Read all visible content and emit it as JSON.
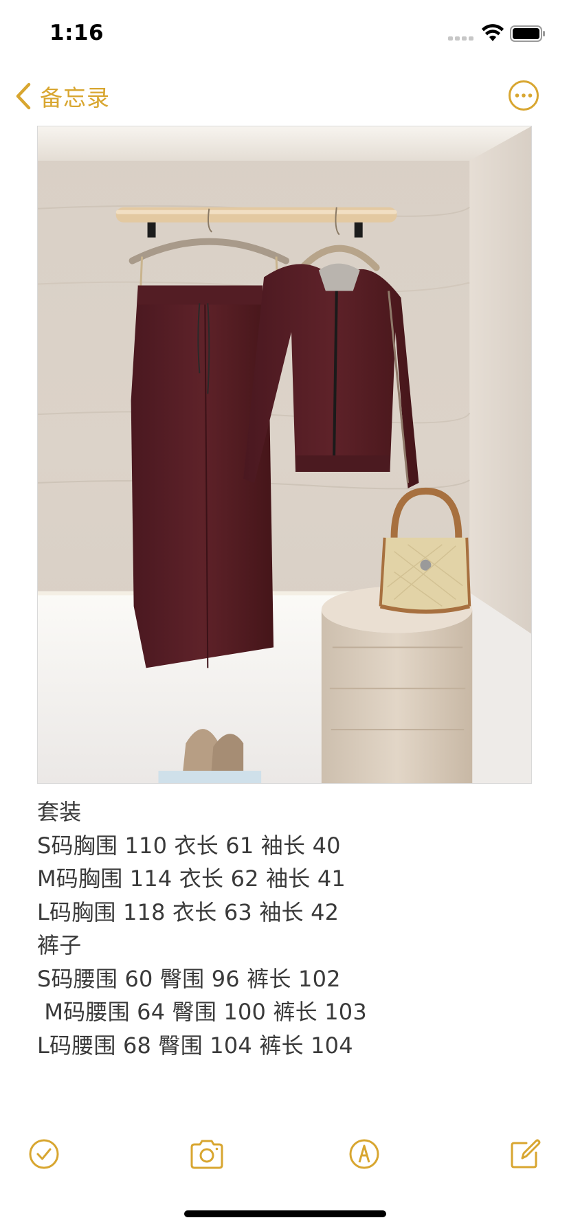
{
  "status_bar": {
    "time": "1:16",
    "icons": [
      "signal-icon",
      "wifi-icon",
      "battery-icon"
    ]
  },
  "nav": {
    "back_label": "备忘录",
    "back_icon": "chevron-left-icon",
    "more_icon": "ellipsis-circle-icon"
  },
  "accent_color": "#d8a630",
  "note": {
    "photo": "burgundy-hoodie-and-wide-leg-pants-on-hanger-photo",
    "lines": [
      "套装",
      "S码胸围 110 衣长 61 袖长 40",
      "M码胸围 114 衣长 62 袖长 41",
      "L码胸围 118 衣长 63 袖长 42",
      "裤子",
      "S码腰围 60 臀围 96 裤长 102",
      " M码腰围 64 臀围 100 裤长 103",
      "L码腰围 68 臀围 104 裤长 104"
    ]
  },
  "toolbar": {
    "items": [
      "checklist-icon",
      "camera-icon",
      "markup-icon",
      "compose-icon"
    ]
  }
}
